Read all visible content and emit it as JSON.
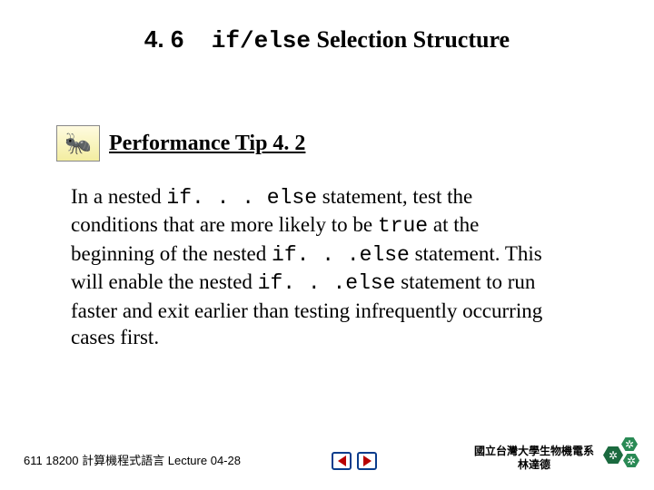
{
  "heading": {
    "section_number": "4. 6",
    "code_part": "if/else",
    "rest": " Selection Structure"
  },
  "tip": {
    "title": "Performance Tip 4. 2",
    "icon_glyph": "🐜"
  },
  "body": {
    "t1": "In a nested ",
    "c1": "if. . . else",
    "t2": " statement, test the conditions that are more likely to be ",
    "c2": "true",
    "t3": " at the beginning of the nested ",
    "c3": "if. . .else",
    "t4": " statement. This will enable the nested ",
    "c4": "if. . .else",
    "t5": " statement to run faster and exit earlier than testing infrequently occurring cases first."
  },
  "footer": {
    "course_code": "611 18200 ",
    "course_cjk": "計算機程式語言",
    "lecture": " Lecture 04-28",
    "affiliation_line1": "國立台灣大學生物機電系",
    "affiliation_line2": "林達德"
  }
}
